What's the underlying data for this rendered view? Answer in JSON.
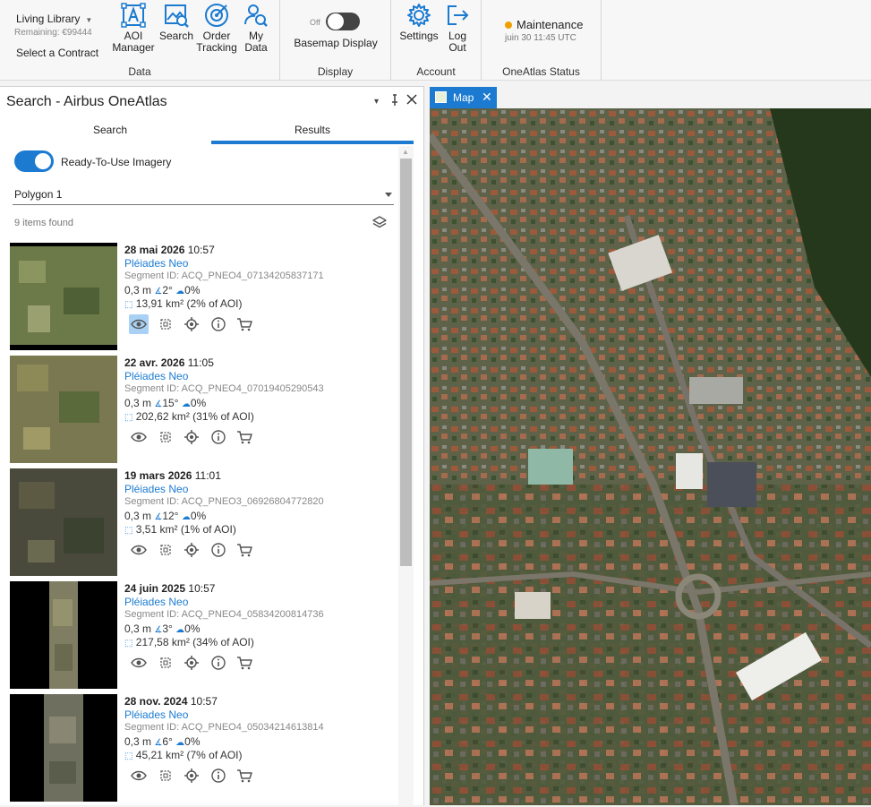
{
  "ribbon": {
    "data_group": {
      "library_name": "Living Library",
      "remaining": "Remaining: €99444",
      "contract": "Select a Contract",
      "aoi_label": "AOI\nManager",
      "search_label": "Search",
      "order_label": "Order\nTracking",
      "mydata_label": "My\nData",
      "group_label": "Data"
    },
    "display_group": {
      "toggle_state": "Off",
      "basemap_label": "Basemap Display",
      "group_label": "Display"
    },
    "account_group": {
      "settings_label": "Settings",
      "logout_label": "Log\nOut",
      "group_label": "Account"
    },
    "status_group": {
      "status": "Maintenance",
      "time": "juin 30 11:45 UTC",
      "group_label": "OneAtlas Status",
      "status_color": "#f0a000"
    }
  },
  "pane": {
    "title": "Search - Airbus OneAtlas",
    "tabs": [
      {
        "label": "Search"
      },
      {
        "label": "Results",
        "active": true
      }
    ],
    "toggle_label": "Ready-To-Use Imagery",
    "polygon": "Polygon 1",
    "items_found": "9 items found",
    "results": [
      {
        "date": "28 mai 2026",
        "time": "10:57",
        "sensor": "Pléiades Neo",
        "segment": "Segment ID: ACQ_PNEO4_07134205837171",
        "res": "0,3 m",
        "angle": "2°",
        "cloud": "0%",
        "area": "13,91 km² (2% of AOI)",
        "thumb": "green"
      },
      {
        "date": "22 avr. 2026",
        "time": "11:05",
        "sensor": "Pléiades Neo",
        "segment": "Segment ID: ACQ_PNEO4_07019405290543",
        "res": "0,3 m",
        "angle": "15°",
        "cloud": "0%",
        "area": "202,62 km² (31% of AOI)",
        "thumb": "brown"
      },
      {
        "date": "19 mars 2026",
        "time": "11:01",
        "sensor": "Pléiades Neo",
        "segment": "Segment ID: ACQ_PNEO3_06926804772820",
        "res": "0,3 m",
        "angle": "12°",
        "cloud": "0%",
        "area": "3,51 km² (1% of AOI)",
        "thumb": "dark"
      },
      {
        "date": "24 juin 2025",
        "time": "10:57",
        "sensor": "Pléiades Neo",
        "segment": "Segment ID: ACQ_PNEO4_05834200814736",
        "res": "0,3 m",
        "angle": "3°",
        "cloud": "0%",
        "area": "217,58 km² (34% of AOI)",
        "thumb": "strip"
      },
      {
        "date": "28 nov. 2024",
        "time": "10:57",
        "sensor": "Pléiades Neo",
        "segment": "Segment ID: ACQ_PNEO4_05034214613814",
        "res": "0,3 m",
        "angle": "6°",
        "cloud": "0%",
        "area": "45,21 km² (7% of AOI)",
        "thumb": "strip2"
      }
    ]
  },
  "map_tab": {
    "label": "Map"
  },
  "colors": {
    "accent": "#1c7bd1"
  }
}
